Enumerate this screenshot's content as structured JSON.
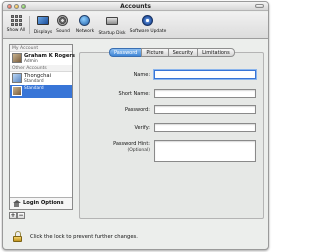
{
  "window": {
    "title": "Accounts"
  },
  "toolbar": {
    "items": [
      {
        "label": "Show All",
        "icon": "show-all-icon"
      },
      {
        "label": "Displays",
        "icon": "displays-icon"
      },
      {
        "label": "Sound",
        "icon": "sound-icon"
      },
      {
        "label": "Network",
        "icon": "network-icon"
      },
      {
        "label": "Startup Disk",
        "icon": "startup-disk-icon"
      },
      {
        "label": "Software Update",
        "icon": "software-update-icon"
      }
    ]
  },
  "accounts": {
    "my_account_header": "My Account",
    "my_account": {
      "name": "Graham K Rogers",
      "role": "Admin"
    },
    "other_accounts_header": "Other Accounts",
    "others": [
      {
        "name": "Thongchai",
        "role": "Standard"
      },
      {
        "name": "",
        "role": "Standard"
      }
    ],
    "login_options_label": "Login Options",
    "add_label": "+",
    "remove_label": "−"
  },
  "tabs": [
    {
      "label": "Password",
      "active": true
    },
    {
      "label": "Picture",
      "active": false
    },
    {
      "label": "Security",
      "active": false
    },
    {
      "label": "Limitations",
      "active": false
    }
  ],
  "form": {
    "name_label": "Name:",
    "name_value": "",
    "short_name_label": "Short Name:",
    "short_name_value": "",
    "password_label": "Password:",
    "password_value": "",
    "verify_label": "Verify:",
    "verify_value": "",
    "hint_label": "Password Hint:",
    "hint_sub": "(Optional)",
    "hint_value": ""
  },
  "lock": {
    "text": "Click the lock to prevent further changes."
  },
  "colors": {
    "selection": "#3875d7",
    "tab_active": "#3f86d6"
  }
}
